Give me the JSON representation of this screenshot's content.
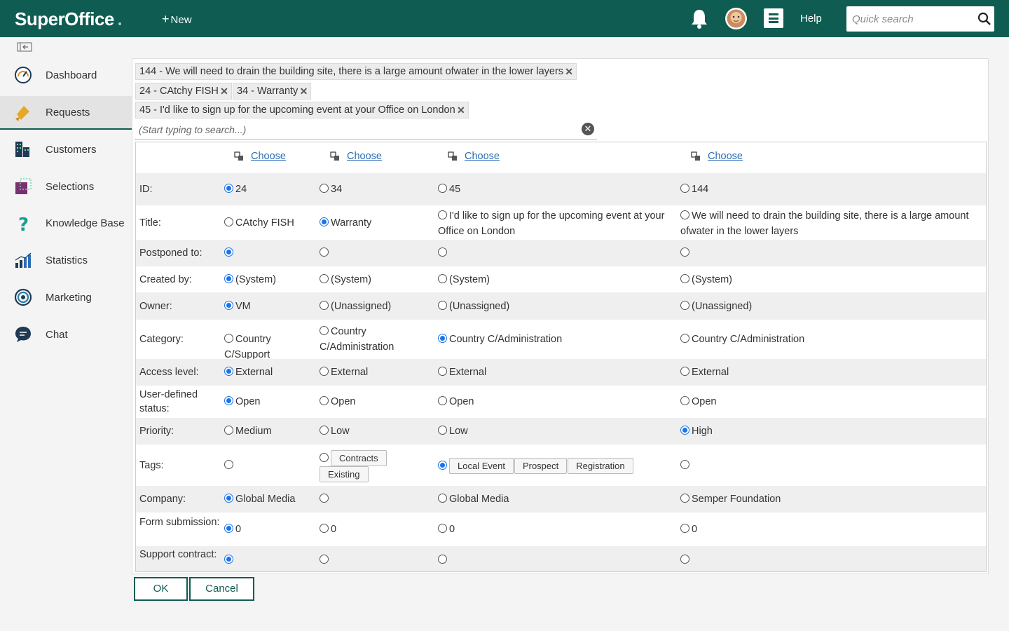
{
  "topbar": {
    "logo": "SuperOffice",
    "new_label": "New",
    "help_label": "Help",
    "search_placeholder": "Quick search",
    "colors": {
      "bar": "#0e5c52",
      "accent": "#1a73e8"
    }
  },
  "sidebar": {
    "items": [
      {
        "label": "Dashboard",
        "icon": "speedometer-icon"
      },
      {
        "label": "Requests",
        "icon": "ticket-icon"
      },
      {
        "label": "Customers",
        "icon": "buildings-icon"
      },
      {
        "label": "Selections",
        "icon": "selection-icon"
      },
      {
        "label": "Knowledge Base",
        "icon": "question-icon"
      },
      {
        "label": "Statistics",
        "icon": "bar-chart-icon"
      },
      {
        "label": "Marketing",
        "icon": "target-icon"
      },
      {
        "label": "Chat",
        "icon": "chat-icon"
      }
    ]
  },
  "chips": [
    "144 - We will need to drain the building site, there is a large amount ofwater in the lower layers",
    "24 - CAtchy FISH",
    "34 - Warranty",
    "45 - I'd like to sign up for the upcoming event at your Office on London"
  ],
  "search": {
    "placeholder": "(Start typing to search...)"
  },
  "grid": {
    "choose_label": "Choose",
    "rows": [
      {
        "label": "ID:",
        "cells": [
          "24",
          "34",
          "45",
          "144"
        ],
        "selected": 0
      },
      {
        "label": "Title:",
        "cells": [
          "CAtchy FISH",
          "Warranty",
          "I'd like to sign up for the upcoming event at your Office on London",
          "We will need to drain the building site, there is a large amount ofwater in the lower layers"
        ],
        "selected": 1
      },
      {
        "label": "Postponed to:",
        "cells": [
          "",
          "",
          "",
          ""
        ],
        "selected": 0
      },
      {
        "label": "Created by:",
        "cells": [
          "(System)",
          "(System)",
          "(System)",
          "(System)"
        ],
        "selected": 0
      },
      {
        "label": "Owner:",
        "cells": [
          "VM",
          "(Unassigned)",
          "(Unassigned)",
          "(Unassigned)"
        ],
        "selected": 0
      },
      {
        "label": "Category:",
        "cells": [
          "Country C/Support",
          "Country C/Administration",
          "Country C/Administration",
          "Country C/Administration"
        ],
        "selected": 2
      },
      {
        "label": "Access level:",
        "cells": [
          "External",
          "External",
          "External",
          "External"
        ],
        "selected": 0
      },
      {
        "label": "User-defined status:",
        "cells": [
          "Open",
          "Open",
          "Open",
          "Open"
        ],
        "selected": 0
      },
      {
        "label": "Priority:",
        "cells": [
          "Medium",
          "Low",
          "Low",
          "High"
        ],
        "selected": 3
      },
      {
        "label": "Tags:",
        "tags": [
          [],
          [
            "Contracts",
            "Existing"
          ],
          [
            "Local Event",
            "Prospect",
            "Registration"
          ],
          []
        ],
        "selected": 2
      },
      {
        "label": "Company:",
        "cells": [
          "Global Media",
          "",
          "Global Media",
          "Semper Foundation"
        ],
        "selected": 0
      },
      {
        "label": "Form submission:",
        "cells": [
          "0",
          "0",
          "0",
          "0"
        ],
        "selected": 0
      },
      {
        "label": "Support contract:",
        "cells": [
          "",
          "",
          "",
          ""
        ],
        "selected": 0
      }
    ]
  },
  "buttons": {
    "ok": "OK",
    "cancel": "Cancel"
  }
}
